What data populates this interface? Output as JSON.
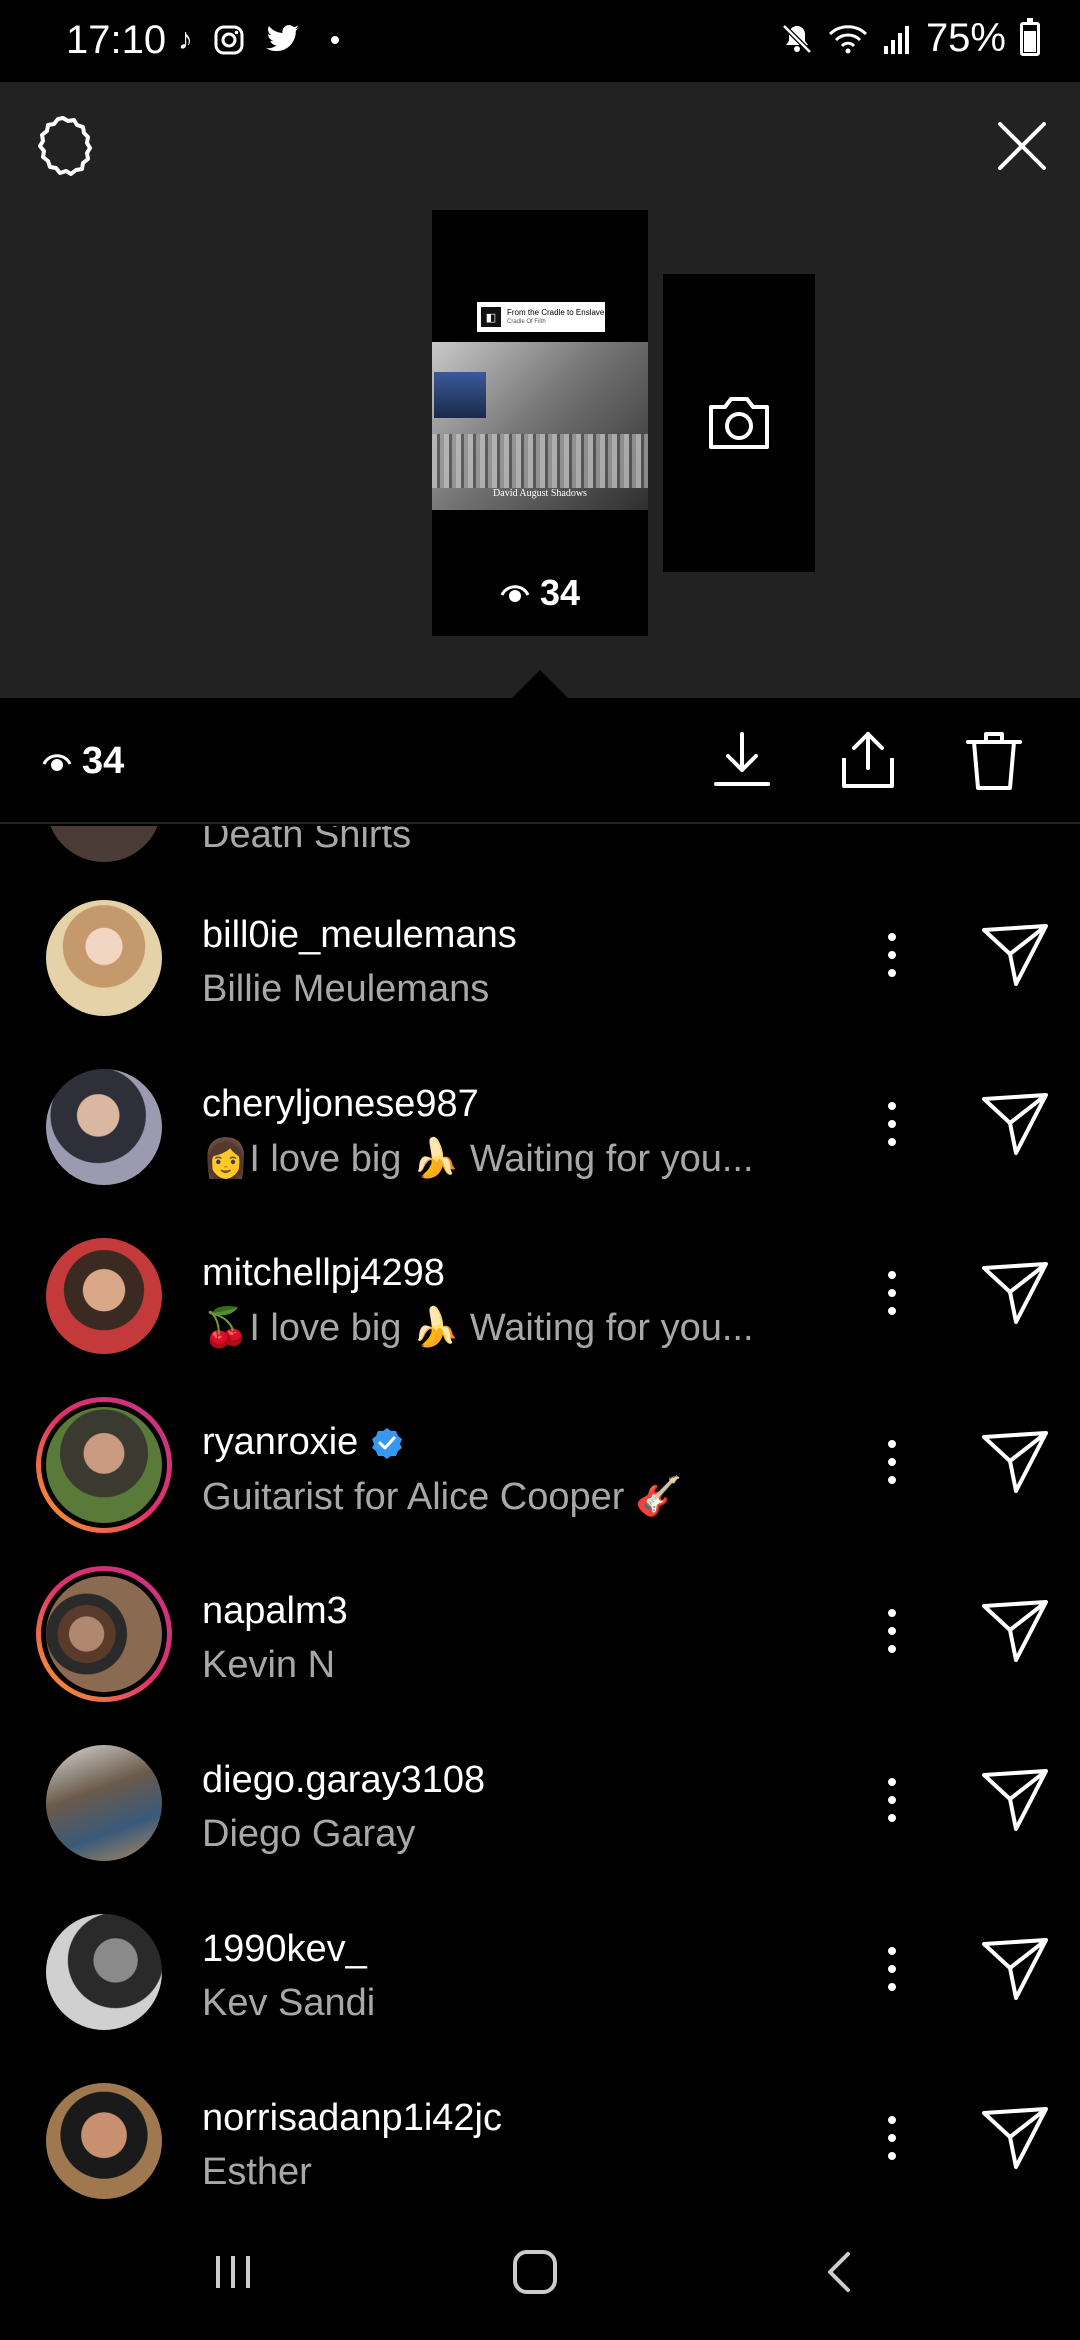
{
  "status_bar": {
    "time": "17:10",
    "app_icons": [
      "tiktok-icon",
      "instagram-icon",
      "twitter-icon"
    ],
    "battery_text": "75%"
  },
  "story": {
    "thumbnail_sticker_title": "From the Cradle to Enslave",
    "thumbnail_sticker_artist": "Cradle Of Filth",
    "thumbnail_caption": "David August Shadows",
    "thumbnail_views": "34"
  },
  "action_bar": {
    "views": "34",
    "icons": [
      "download-icon",
      "share-icon",
      "trash-icon"
    ]
  },
  "viewers": [
    {
      "username": "bill0ie_meulemans",
      "subtitle": "Billie Meulemans",
      "verified": false,
      "story_ring": false
    },
    {
      "username": "cheryljonese987",
      "subtitle": "👩I love big 🍌 Waiting for you...",
      "verified": false,
      "story_ring": false
    },
    {
      "username": "mitchellpj4298",
      "subtitle": "🍒I love big 🍌 Waiting for you...",
      "verified": false,
      "story_ring": false
    },
    {
      "username": "ryanroxie",
      "subtitle": "Guitarist for Alice Cooper 🎸",
      "verified": true,
      "story_ring": true
    },
    {
      "username": "napalm3",
      "subtitle": "Kevin N",
      "verified": false,
      "story_ring": true
    },
    {
      "username": "diego.garay3108",
      "subtitle": "Diego Garay",
      "verified": false,
      "story_ring": false
    },
    {
      "username": "1990kev_",
      "subtitle": "Kev Sandi",
      "verified": false,
      "story_ring": false
    },
    {
      "username": "norrisadanp1i42jc",
      "subtitle": "Esther",
      "verified": false,
      "story_ring": false
    }
  ],
  "partial_top_row_subtitle": "Death Shirts",
  "colors": {
    "background": "#000000",
    "top_panel": "#222222",
    "secondary_text": "#a8a8a8",
    "verified_blue": "#3897f0"
  }
}
